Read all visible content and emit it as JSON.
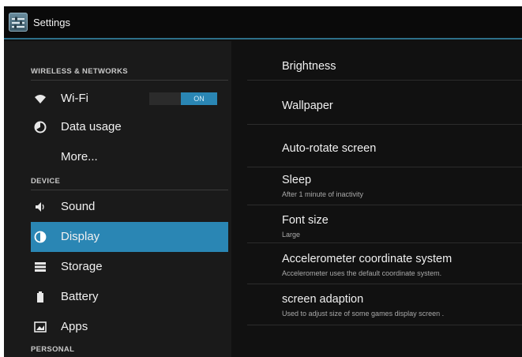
{
  "app": {
    "title": "Settings",
    "icon": "settings-app-icon"
  },
  "colors": {
    "accent": "#2a86b4",
    "background": "#101010"
  },
  "sidebar": {
    "sections": [
      {
        "label": "WIRELESS & NETWORKS"
      },
      {
        "label": "DEVICE"
      },
      {
        "label": "PERSONAL"
      }
    ],
    "items": [
      {
        "label": "Wi-Fi",
        "icon": "wifi-icon",
        "toggle": "ON"
      },
      {
        "label": "Data usage",
        "icon": "data-usage-icon"
      },
      {
        "label": "More..."
      },
      {
        "label": "Sound",
        "icon": "speaker-icon"
      },
      {
        "label": "Display",
        "icon": "display-icon",
        "selected": true
      },
      {
        "label": "Storage",
        "icon": "storage-icon"
      },
      {
        "label": "Battery",
        "icon": "battery-icon"
      },
      {
        "label": "Apps",
        "icon": "apps-icon"
      }
    ]
  },
  "display_settings": [
    {
      "title": "Brightness"
    },
    {
      "title": "Wallpaper"
    },
    {
      "title": "Auto-rotate screen"
    },
    {
      "title": "Sleep",
      "summary": "After 1 minute of inactivity"
    },
    {
      "title": "Font size",
      "summary": "Large"
    },
    {
      "title": "Accelerometer coordinate system",
      "summary": "Accelerometer uses the default coordinate system."
    },
    {
      "title": "screen adaption",
      "summary": "Used to adjust size of some games display screen ."
    }
  ]
}
